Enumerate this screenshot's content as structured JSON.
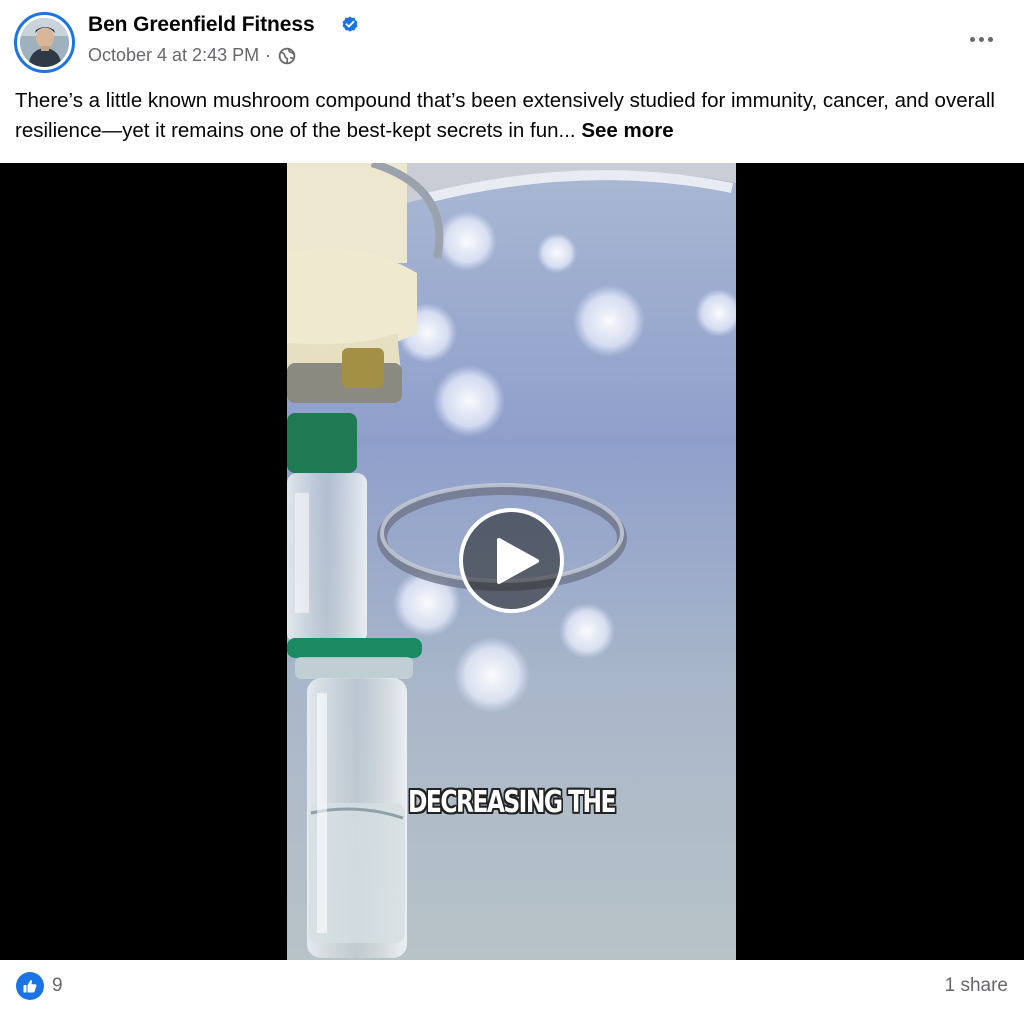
{
  "post": {
    "author": "Ben Greenfield Fitness",
    "timestamp": "October 4 at 2:43 PM",
    "separator": "·",
    "privacy_icon": "globe-icon",
    "verified_icon": "verified-badge-icon",
    "text": "There’s a little known mushroom compound that’s been extensively studied for immunity, cancer, and overall resilience—yet it remains one of the best-kept secrets in fun...",
    "see_more_label": "See more"
  },
  "video": {
    "caption": "DECREASING THE",
    "play_icon": "play-icon"
  },
  "footer": {
    "reaction_icon": "like-icon",
    "reaction_count": "9",
    "share_count": "1 share"
  },
  "colors": {
    "accent": "#1b74e4",
    "secondary_text": "#65676b",
    "video_background": "#000000"
  }
}
